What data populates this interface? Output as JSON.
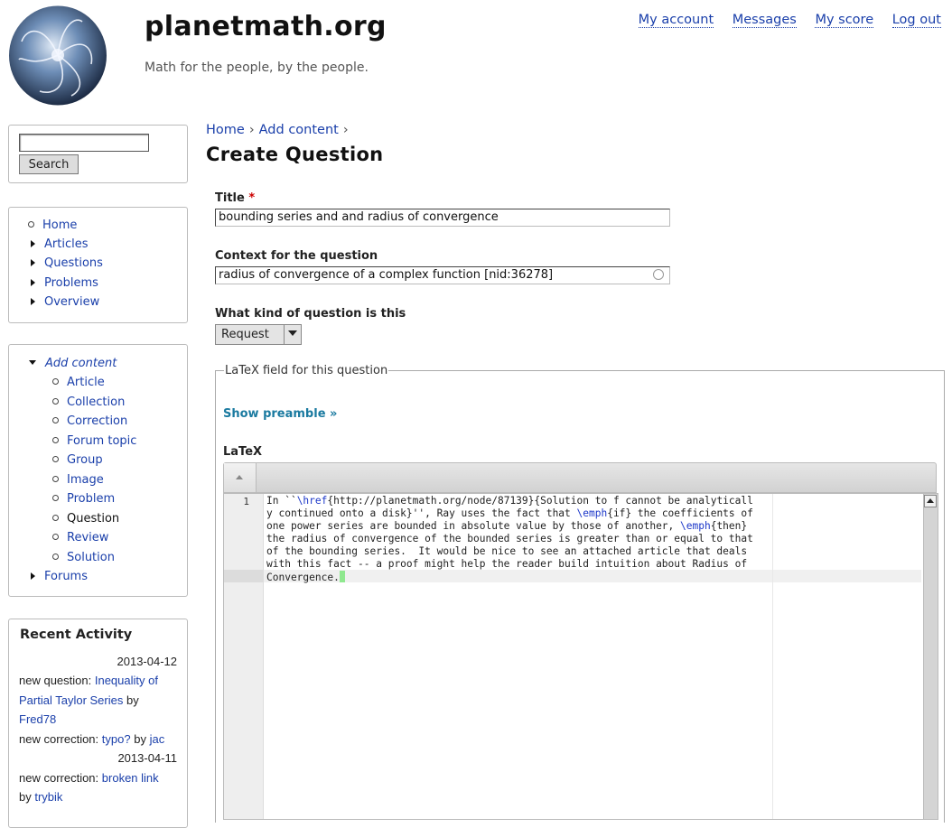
{
  "header": {
    "site_name": "planetmath.org",
    "slogan": "Math for the people, by the people.",
    "links": [
      "My account",
      "Messages",
      "My score",
      "Log out"
    ]
  },
  "search": {
    "value": "",
    "button": "Search"
  },
  "nav": {
    "items": [
      "Home",
      "Articles",
      "Questions",
      "Problems",
      "Overview"
    ]
  },
  "add_content": {
    "label": "Add content",
    "items": [
      "Article",
      "Collection",
      "Correction",
      "Forum topic",
      "Group",
      "Image",
      "Problem",
      "Question",
      "Review",
      "Solution"
    ],
    "active": "Question",
    "forums": "Forums"
  },
  "recent": {
    "title": "Recent Activity",
    "date1": "2013-04-12",
    "a1_prefix": "new question:",
    "a1_link1": "Inequality of",
    "a1_link2": "Partial Taylor Series",
    "a1_by": "by",
    "a1_user": "Fred78",
    "a2_prefix": "new correction:",
    "a2_link": "typo?",
    "a2_by": "by",
    "a2_user": "jac",
    "date2": "2013-04-11",
    "a3_prefix": "new correction:",
    "a3_link": "broken link",
    "a3_by": "by",
    "a3_user": "trybik"
  },
  "breadcrumb": {
    "home": "Home",
    "sep": "›",
    "add_content": "Add content"
  },
  "page_title": "Create Question",
  "form": {
    "title_label": "Title",
    "required_mark": "*",
    "title_value": "bounding series and and radius of convergence",
    "context_label": "Context for the question",
    "context_value": "radius of convergence of a complex function [nid:36278]",
    "kind_label": "What kind of question is this",
    "kind_value": "Request",
    "fieldset_legend": "LaTeX field for this question",
    "show_preamble": "Show preamble »",
    "latex_label": "LaTeX"
  },
  "editor": {
    "line_number": "1",
    "lines": [
      [
        "In ``",
        "\\href",
        "{http://planetmath.org/node/87139}{Solution to f cannot be analyticall"
      ],
      [
        "y continued onto a disk}'', Ray uses the fact that ",
        "\\emph",
        "{if} the coefficients of"
      ],
      [
        "one power series are bounded in absolute value by those of another, ",
        "\\emph",
        "{then}"
      ],
      [
        "the radius of convergence of the bounded series is greater than or equal to that"
      ],
      [
        "of the bounding series.  It would be nice to see an attached article that deals"
      ],
      [
        "with this fact -- a proof might help the reader build intuition about Radius of"
      ],
      [
        "Convergence."
      ]
    ]
  }
}
